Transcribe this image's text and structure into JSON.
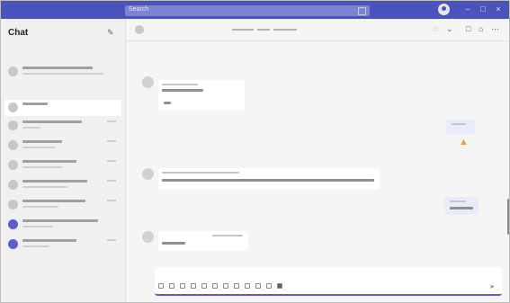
{
  "topbar": {
    "search_placeholder": "Search"
  },
  "chat": {
    "title": "Chat"
  }
}
